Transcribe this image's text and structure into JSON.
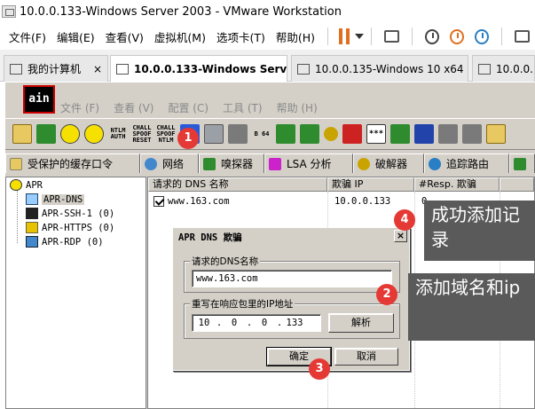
{
  "window": {
    "title": "10.0.0.133-Windows Server 2003 - VMware Workstation"
  },
  "vmware_menu": [
    "文件(F)",
    "编辑(E)",
    "查看(V)",
    "虚拟机(M)",
    "选项卡(T)",
    "帮助(H)"
  ],
  "vm_tabs": [
    {
      "label": "我的计算机",
      "close": "×"
    },
    {
      "label": "10.0.0.133-Windows Serv…",
      "close": "×"
    },
    {
      "label": "10.0.0.135-Windows 10 x64",
      "close": "×"
    },
    {
      "label": "10.0.0."
    }
  ],
  "cain": {
    "logo": "ain",
    "menu": [
      "文件 (F)",
      "查看 (V)",
      "配置 (C)",
      "工具 (T)",
      "帮助 (H)"
    ],
    "toolbar_text": {
      "ntlm_auth": "NTLM AUTH",
      "chall_spoof_reset": "CHALL SPOOF RESET",
      "chall_spoof_ntlm": "CHALL SPOOF NTLM",
      "b64": "B 64",
      "stars": "***"
    },
    "tabs": [
      "受保护的缓存口令",
      "网络",
      "嗅探器",
      "LSA 分析",
      "破解器",
      "追踪路由"
    ],
    "tree": {
      "root": "APR",
      "children": [
        "APR-DNS",
        "APR-SSH-1 (0)",
        "APR-HTTPS (0)",
        "APR-RDP (0)"
      ]
    },
    "list": {
      "headers": [
        "请求的 DNS 名称",
        "欺骗 IP",
        "#Resp. 欺骗"
      ],
      "rows": [
        {
          "dns": "www.163.com",
          "ip": "10.0.0.133",
          "resp": "0"
        }
      ]
    }
  },
  "dialog": {
    "title": "APR DNS 欺骗",
    "close": "×",
    "dns_group_label": "请求的DNS名称",
    "dns_value": "www.163.com",
    "ip_group_label": "重写在响应包里的IP地址",
    "ip_octets": [
      "10",
      "0",
      "0",
      "133"
    ],
    "resolve_button": "解析",
    "ok_button": "确定",
    "cancel_button": "取消"
  },
  "annotations": {
    "markers": [
      "1",
      "2",
      "3",
      "4"
    ],
    "callout_2": "添加域名和ip",
    "callout_4": "成功添加记录"
  },
  "colors": {
    "marker": "#e53935",
    "callout_bg": "#5a5a5a",
    "pause_orange": "#e07020"
  }
}
